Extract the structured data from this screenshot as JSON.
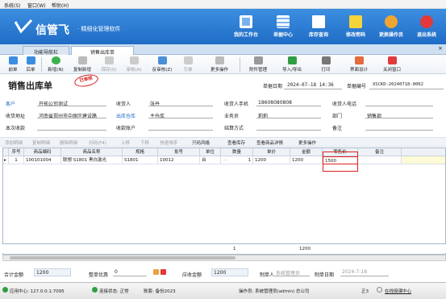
{
  "menu": [
    "系统(S)",
    "窗口(W)",
    "帮助(H)"
  ],
  "brand": {
    "name": "信管飞",
    "subtitle": "· 精细化管理软件"
  },
  "header_buttons": [
    {
      "label": "我的工作台",
      "color": "#ffffff"
    },
    {
      "label": "单据中心",
      "color": "#ffffff"
    },
    {
      "label": "库存查询",
      "color": "#ffffff"
    },
    {
      "label": "修改密码",
      "color": "#f5d33a"
    },
    {
      "label": "更换操作员",
      "color": "#f0a531"
    },
    {
      "label": "退出系统",
      "color": "#e23a3a"
    }
  ],
  "tabs": [
    {
      "label": "功能导航栏"
    },
    {
      "label": "销售出库单"
    }
  ],
  "toolbar": [
    "前单",
    "后单",
    "新增(N)",
    "复制新增",
    "保存(S)",
    "审核(A)",
    "反审核(Z)",
    "引单",
    "更多操作",
    "附件管理",
    "导入/导出",
    "打印",
    "界面设计",
    "关闭窗口"
  ],
  "doc": {
    "title": "销售出库单",
    "stamp": "已审核",
    "date_label": "单据日期",
    "date_value": "2024-07-18 14:36",
    "no_label": "单据编号",
    "no_value": "XSCKD-20240718-0002"
  },
  "form": {
    "customer_label": "客户",
    "customer": "开拓公司测试",
    "receiver_label": "收货人",
    "receiver": "张丹",
    "receiver_phone_label": "收货人手机",
    "receiver_phone": "18608080808",
    "receiver_tel_label": "收货人电话",
    "receiver_tel": "",
    "address_label": "收货地址",
    "address": "河南省郑州市中原区建设路",
    "warehouse_label": "出库仓库",
    "warehouse": "主仓库",
    "staff_label": "业务员",
    "staff": "莉莉",
    "dept_label": "部门",
    "dept": "销售部",
    "collect_label": "本次收款",
    "collect": "",
    "account_label": "收款账户",
    "account": "",
    "settle_label": "结算方式",
    "settle": "",
    "note_label": "备注",
    "note": ""
  },
  "grid_toolbar": [
    "添加明细",
    "复制明细",
    "删除明细",
    "扫码(F4)",
    "上移",
    "下移",
    "快速排序",
    "只码风格",
    "查看库存",
    "查看商品详情",
    "更多操作"
  ],
  "columns": [
    "序号",
    "商品编码",
    "商品名称",
    "规格",
    "批号",
    "单位",
    "数量",
    "单价",
    "金额",
    "零售价",
    "备注"
  ],
  "rows": [
    {
      "no": "1",
      "code": "100101004",
      "name": "联想 S1801 黑白激光",
      "spec": "S1801",
      "batch": "10012",
      "unit": "台",
      "qty": "1",
      "price": "1200",
      "amount": "1200",
      "retail": "1500",
      "note": ""
    }
  ],
  "totals": {
    "qty": "1",
    "amount": "1200"
  },
  "footer": {
    "total_label": "合计金额",
    "total": "1200",
    "discount_label": "整单优惠",
    "discount": "0",
    "receivable_label": "应收金额",
    "receivable": "1200",
    "maker_label": "制单人",
    "maker": "系统管理员",
    "make_date_label": "制单日期",
    "make_date": "2024-7-18"
  },
  "status": {
    "app_center": "应用中心: 127.0.0.1:7095",
    "conn": "连接状态: 正常",
    "account_set": "账套: 备份2023",
    "operator": "操作员: 系统管理员(admin) 总公司",
    "count": "正3",
    "online": "在线授课中心"
  }
}
